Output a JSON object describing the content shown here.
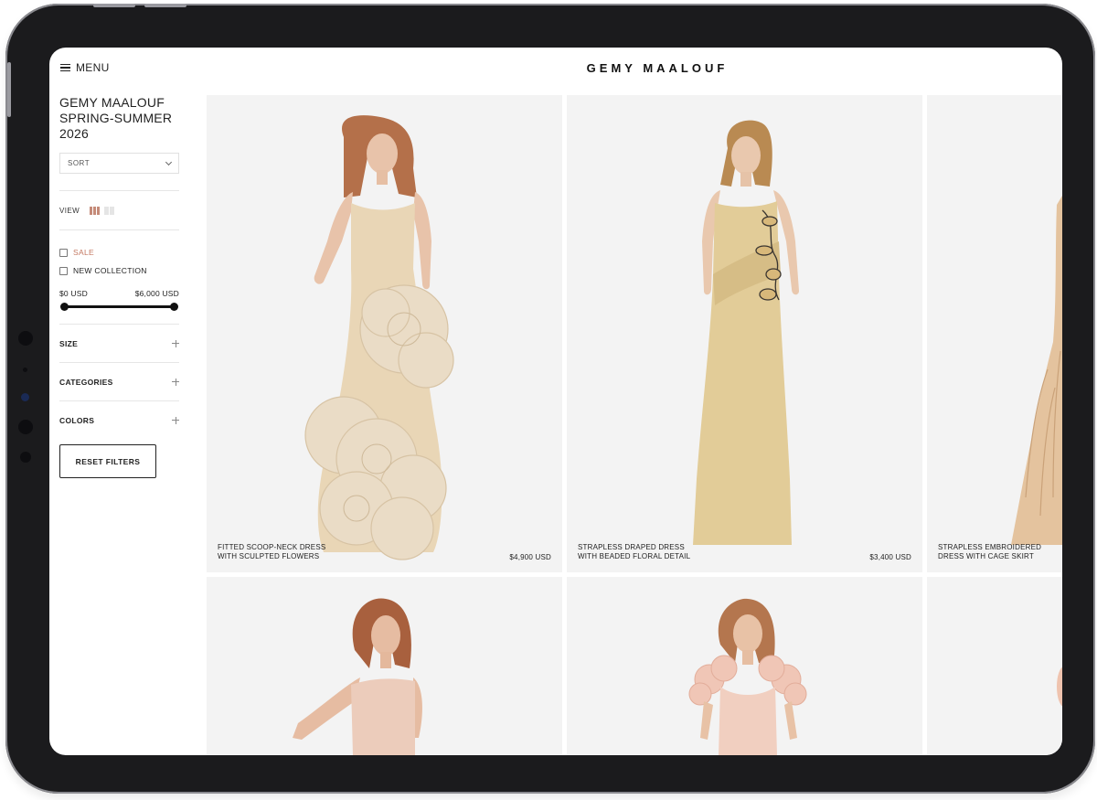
{
  "header": {
    "menu_label": "MENU",
    "brand": "GEMY MAALOUF"
  },
  "sidebar": {
    "title_line1": "GEMY MAALOUF",
    "title_line2": "SPRING-SUMMER",
    "title_line3": "2026",
    "sort_label": "SORT",
    "view_label": "VIEW",
    "filters": {
      "sale": "SALE",
      "new_collection": "NEW COLLECTION"
    },
    "price": {
      "min": "$0 USD",
      "max": "$6,000 USD"
    },
    "accordions": {
      "size": "SIZE",
      "categories": "CATEGORIES",
      "colors": "COLORS"
    },
    "reset_label": "RESET FILTERS"
  },
  "products": [
    {
      "line1": "FITTED SCOOP-NECK DRESS",
      "line2": "WITH SCULPTED FLOWERS",
      "price": "$4,900 USD"
    },
    {
      "line1": "STRAPLESS DRAPED DRESS",
      "line2": "WITH BEADED FLORAL DETAIL",
      "price": "$3,400 USD"
    },
    {
      "line1": "STRAPLESS EMBROIDERED",
      "line2": "DRESS WITH CAGE SKIRT",
      "price": ""
    }
  ],
  "colors": {
    "accent_sale": "#c47a63",
    "view_active": "#c58b79",
    "card_bg": "#f3f3f3"
  }
}
